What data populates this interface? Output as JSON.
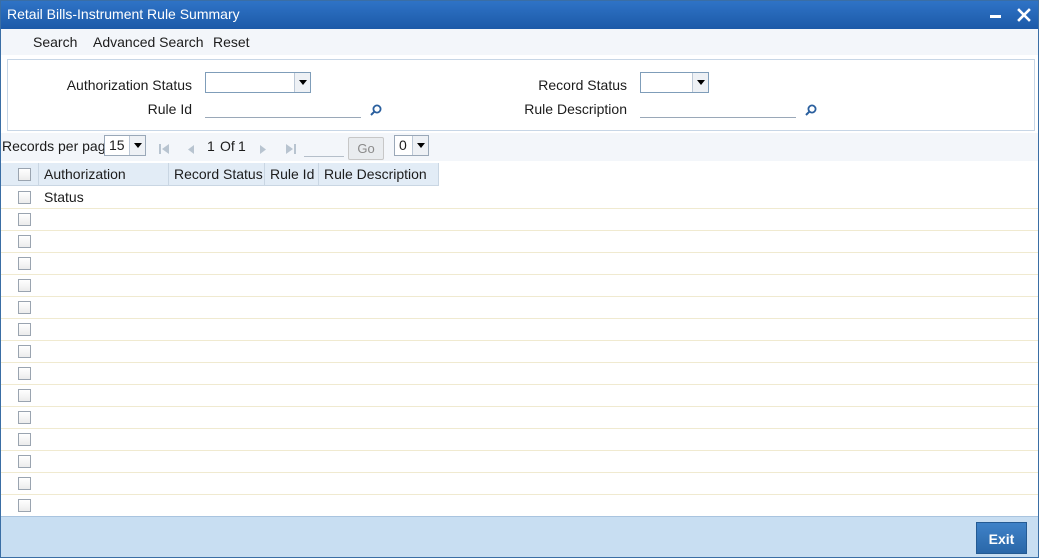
{
  "window": {
    "title": "Retail Bills-Instrument Rule Summary"
  },
  "toolbar": {
    "search_label": "Search",
    "advanced_search_label": "Advanced Search",
    "reset_label": "Reset"
  },
  "criteria": {
    "authorization_status_label": "Authorization Status",
    "authorization_status_value": "",
    "record_status_label": "Record Status",
    "record_status_value": "",
    "rule_id_label": "Rule Id",
    "rule_id_value": "",
    "rule_description_label": "Rule Description",
    "rule_description_value": ""
  },
  "pager": {
    "records_per_page_label": "Records per page",
    "records_per_page_value": "15",
    "current_page": "1",
    "of_label": "Of",
    "total_pages": "1",
    "go_label": "Go",
    "selector_value": "0"
  },
  "grid": {
    "columns": [
      "Authorization Status",
      "Record Status",
      "Rule Id",
      "Rule Description"
    ],
    "row_count": 15
  },
  "footer": {
    "exit_label": "Exit"
  },
  "colors": {
    "titlebar": "#1f5fae",
    "footer": "#c8def2",
    "exit_button": "#3575b9"
  },
  "icons": [
    "minimize-icon",
    "close-icon",
    "search-lens-icon",
    "dropdown-arrow-icon",
    "first-page-icon",
    "previous-page-icon",
    "next-page-icon",
    "last-page-icon"
  ]
}
